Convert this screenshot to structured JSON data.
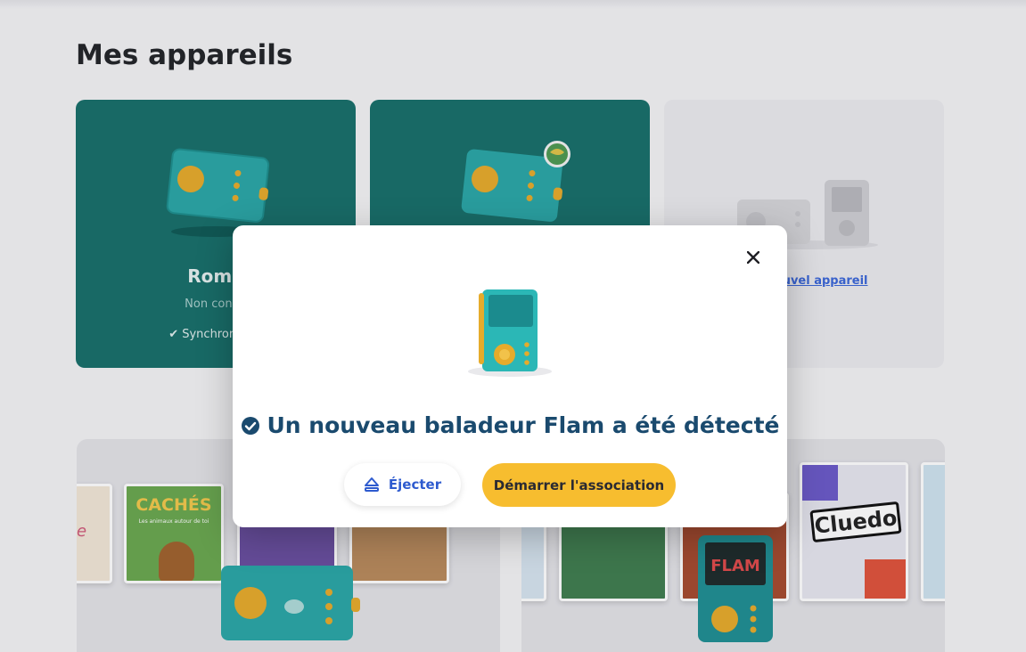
{
  "page": {
    "title": "Mes appareils"
  },
  "devices": [
    {
      "name": "Roma",
      "status": "Non conne",
      "sync": "Synchronisé il"
    },
    {
      "name": "",
      "status": "",
      "sync": ""
    }
  ],
  "add_device": {
    "label": "un nouvel appareil"
  },
  "promos": {
    "left": {
      "book_titles": [
        "CACHÉS",
        "Les animaux autour de toi"
      ]
    },
    "right": {
      "book_titles": [
        "Cluedo",
        "FLAM"
      ]
    }
  },
  "modal": {
    "title": "Un nouveau baladeur Flam a été détecté",
    "eject_label": "Éjecter",
    "associate_label": "Démarrer l'association"
  },
  "icons": {
    "close": "close-icon",
    "check": "check-circle-icon",
    "eject": "eject-icon",
    "player": "flam-player-icon"
  },
  "colors": {
    "teal_card": "#176f6a",
    "accent_yellow": "#f7bd2f",
    "title_navy": "#1a4a6e",
    "link_blue": "#2e5bcf"
  }
}
